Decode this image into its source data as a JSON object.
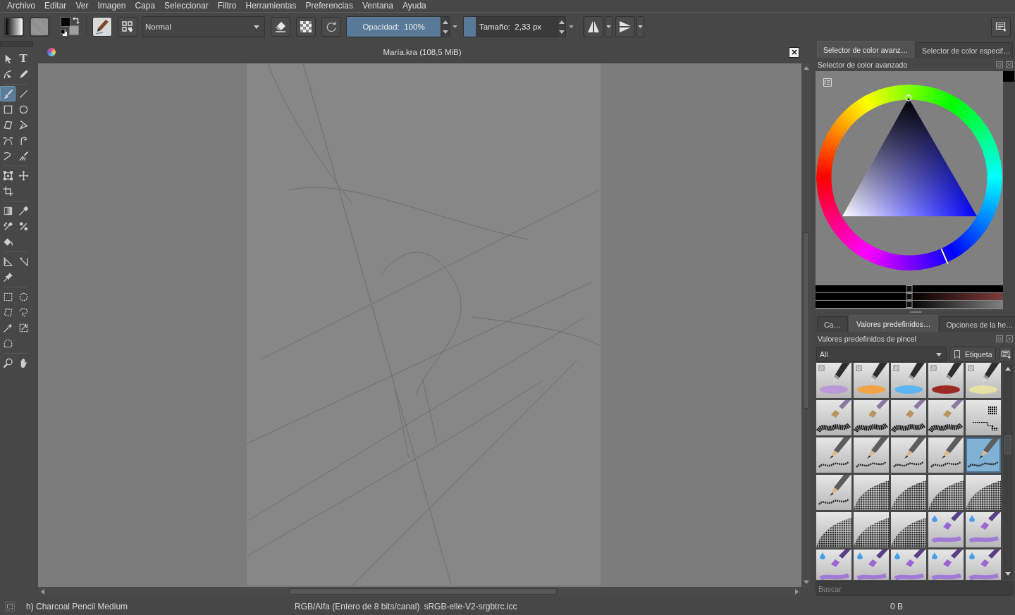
{
  "menu": [
    "Archivo",
    "Editar",
    "Ver",
    "Imagen",
    "Capa",
    "Seleccionar",
    "Filtro",
    "Herramientas",
    "Preferencias",
    "Ventana",
    "Ayuda"
  ],
  "toolbar": {
    "blend_mode": "Normal",
    "opacity": {
      "text": "Opacidad:  100%",
      "level": 1
    },
    "size": {
      "text": "Tamaño:  2,33 px",
      "level": 0.13
    }
  },
  "toolbox": {
    "groups": [
      {
        "tools": [
          {
            "kind": "pointer",
            "selected": false
          },
          {
            "kind": "text",
            "glyph": "T",
            "selected": false
          },
          {
            "kind": "shapeedit",
            "selected": false
          },
          {
            "kind": "calligraphy",
            "selected": false
          }
        ]
      },
      {
        "tools": [
          {
            "kind": "brush",
            "selected": true
          },
          {
            "kind": "line",
            "selected": false
          },
          {
            "kind": "rectangle",
            "selected": false
          },
          {
            "kind": "ellipse",
            "selected": false
          },
          {
            "kind": "polygon",
            "selected": false
          },
          {
            "kind": "polyline",
            "selected": false
          },
          {
            "kind": "bezier",
            "selected": false
          },
          {
            "kind": "freehand",
            "selected": false
          },
          {
            "kind": "dynamic",
            "selected": false
          },
          {
            "kind": "multibrush",
            "selected": false
          }
        ]
      },
      {
        "tools": [
          {
            "kind": "transform",
            "selected": false
          },
          {
            "kind": "move",
            "selected": false
          },
          {
            "kind": "crop",
            "selected": false
          }
        ]
      },
      {
        "tools": [
          {
            "kind": "gradient",
            "selected": false
          },
          {
            "kind": "picker",
            "selected": false
          },
          {
            "kind": "colorize",
            "selected": false
          },
          {
            "kind": "patch",
            "selected": false
          },
          {
            "kind": "fill",
            "selected": false
          }
        ]
      },
      {
        "tools": [
          {
            "kind": "assistant",
            "selected": false
          },
          {
            "kind": "measure",
            "selected": false
          },
          {
            "kind": "reference",
            "selected": false
          }
        ]
      },
      {
        "tools": [
          {
            "kind": "rectselect",
            "selected": false
          },
          {
            "kind": "ellipseselect",
            "selected": false
          },
          {
            "kind": "polyselect",
            "selected": false
          },
          {
            "kind": "lassoselect",
            "selected": false
          },
          {
            "kind": "wandselect",
            "selected": false
          },
          {
            "kind": "similarselect",
            "selected": false
          },
          {
            "kind": "bezierselect",
            "selected": false
          }
        ]
      },
      {
        "tools": [
          {
            "kind": "zoom",
            "selected": false
          },
          {
            "kind": "pan",
            "selected": false
          }
        ]
      }
    ]
  },
  "document": {
    "title": "María.kra (108,5 MiB)"
  },
  "color_dock": {
    "tabs": [
      {
        "label": "Selector de color avanz…",
        "selected": true
      },
      {
        "label": "Selector de color especif…",
        "selected": false
      }
    ],
    "title": "Selector de color avanzado",
    "shade_sliders": [
      {
        "level": 0.5
      },
      {
        "level": 0.5
      },
      {
        "level": 0.5
      }
    ]
  },
  "brush_dock": {
    "tabs": [
      {
        "label": "Ca…",
        "selected": false
      },
      {
        "label": "Valores predefinidos…",
        "selected": true
      },
      {
        "label": "Opciones de la he…",
        "selected": false
      }
    ],
    "title": "Valores predefinidos de pincel",
    "filter": "All",
    "tag_button": "Etiqueta",
    "presets": [
      {
        "kind": "airbrush",
        "color": "#b99ad6",
        "selected": false
      },
      {
        "kind": "airbrush",
        "color": "#f0a347",
        "selected": false
      },
      {
        "kind": "airbrush",
        "color": "#5db4f2",
        "selected": false
      },
      {
        "kind": "airbrush",
        "color": "#9c2a24",
        "selected": false
      },
      {
        "kind": "airbrush",
        "color": "#e6e2a6",
        "selected": false
      },
      {
        "kind": "bristle",
        "selected": false
      },
      {
        "kind": "bristle",
        "selected": false
      },
      {
        "kind": "bristle",
        "selected": false
      },
      {
        "kind": "bristle",
        "selected": false
      },
      {
        "kind": "pixel",
        "selected": false
      },
      {
        "kind": "pencil",
        "selected": false
      },
      {
        "kind": "pencil",
        "selected": false
      },
      {
        "kind": "pencil",
        "selected": false
      },
      {
        "kind": "pencil",
        "selected": false
      },
      {
        "kind": "pencil",
        "selected": true
      },
      {
        "kind": "pencil",
        "selected": false
      },
      {
        "kind": "texture",
        "selected": false
      },
      {
        "kind": "texture",
        "selected": false
      },
      {
        "kind": "texture",
        "selected": false
      },
      {
        "kind": "texture",
        "selected": false
      },
      {
        "kind": "texture",
        "selected": false
      },
      {
        "kind": "texture",
        "selected": false
      },
      {
        "kind": "texture",
        "selected": false
      },
      {
        "kind": "wet",
        "selected": false
      },
      {
        "kind": "wet",
        "selected": false
      },
      {
        "kind": "wet",
        "selected": false
      },
      {
        "kind": "wet",
        "selected": false
      },
      {
        "kind": "wet",
        "selected": false
      },
      {
        "kind": "wet",
        "selected": false
      },
      {
        "kind": "wet",
        "selected": false
      }
    ],
    "search": {
      "placeholder": "Buscar"
    }
  },
  "status_bar": {
    "brush": "h) Charcoal Pencil Medium",
    "color_space": "RGB/Alfa (Entero de 8 bits/canal)",
    "profile": "sRGB-elle-V2-srgbtrc.icc",
    "memory": "0 B"
  }
}
